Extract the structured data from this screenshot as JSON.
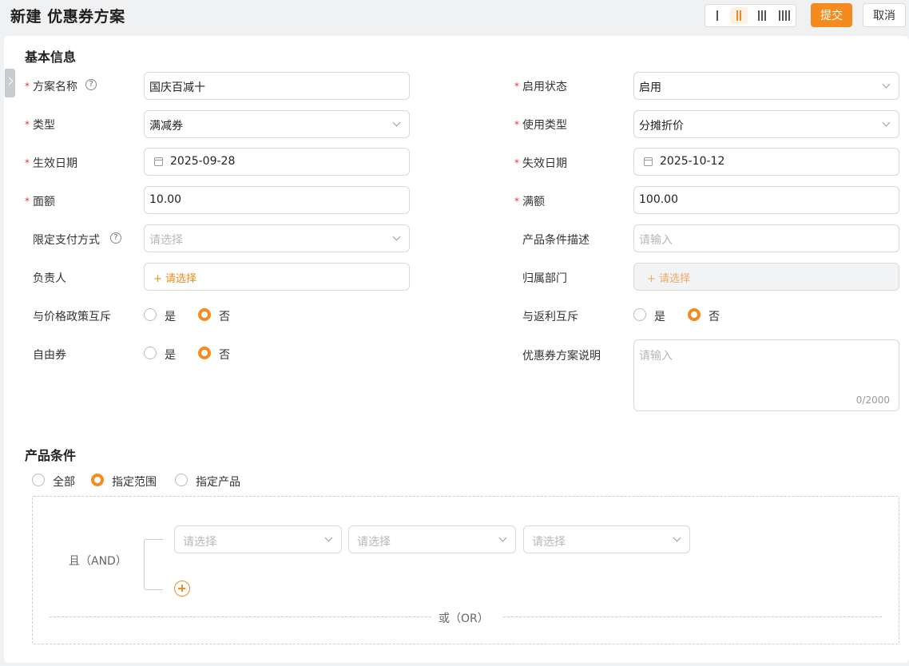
{
  "header": {
    "title": "新建 优惠券方案",
    "submit_label": "提交",
    "cancel_label": "取消"
  },
  "basic_info": {
    "title": "基本信息",
    "scheme_name": {
      "label": "方案名称",
      "value": "国庆百减十"
    },
    "enable_status": {
      "label": "启用状态",
      "value": "启用"
    },
    "type": {
      "label": "类型",
      "value": "满减券"
    },
    "usage_type": {
      "label": "使用类型",
      "value": "分摊折价"
    },
    "start_date": {
      "label": "生效日期",
      "value": "2025-09-28"
    },
    "end_date": {
      "label": "失效日期",
      "value": "2025-10-12"
    },
    "face_value": {
      "label": "面额",
      "value": "10.00"
    },
    "full_amount": {
      "label": "满额",
      "value": "100.00"
    },
    "payment_method": {
      "label": "限定支付方式",
      "placeholder": "请选择"
    },
    "product_condition_desc": {
      "label": "产品条件描述",
      "placeholder": "请输入"
    },
    "owner": {
      "label": "负责人",
      "add_label": "+ 请选择"
    },
    "department": {
      "label": "归属部门",
      "add_label": "+ 请选择"
    },
    "price_policy_exclusive": {
      "label": "与价格政策互斥",
      "yes": "是",
      "no": "否",
      "selected": "否"
    },
    "rebate_exclusive": {
      "label": "与返利互斥",
      "yes": "是",
      "no": "否",
      "selected": "否"
    },
    "free_coupon": {
      "label": "自由券",
      "yes": "是",
      "no": "否",
      "selected": "否"
    },
    "description": {
      "label": "优惠券方案说明",
      "placeholder": "请输入",
      "counter": "0/2000"
    }
  },
  "product_condition": {
    "title": "产品条件",
    "options": [
      "全部",
      "指定范围",
      "指定产品"
    ],
    "selected": "指定范围",
    "and_label": "且（AND）",
    "or_label": "或（OR）",
    "select_placeholders": [
      "请选择",
      "请选择",
      "请选择"
    ]
  },
  "colors": {
    "accent": "#f58a1f",
    "required": "#e4393c"
  }
}
